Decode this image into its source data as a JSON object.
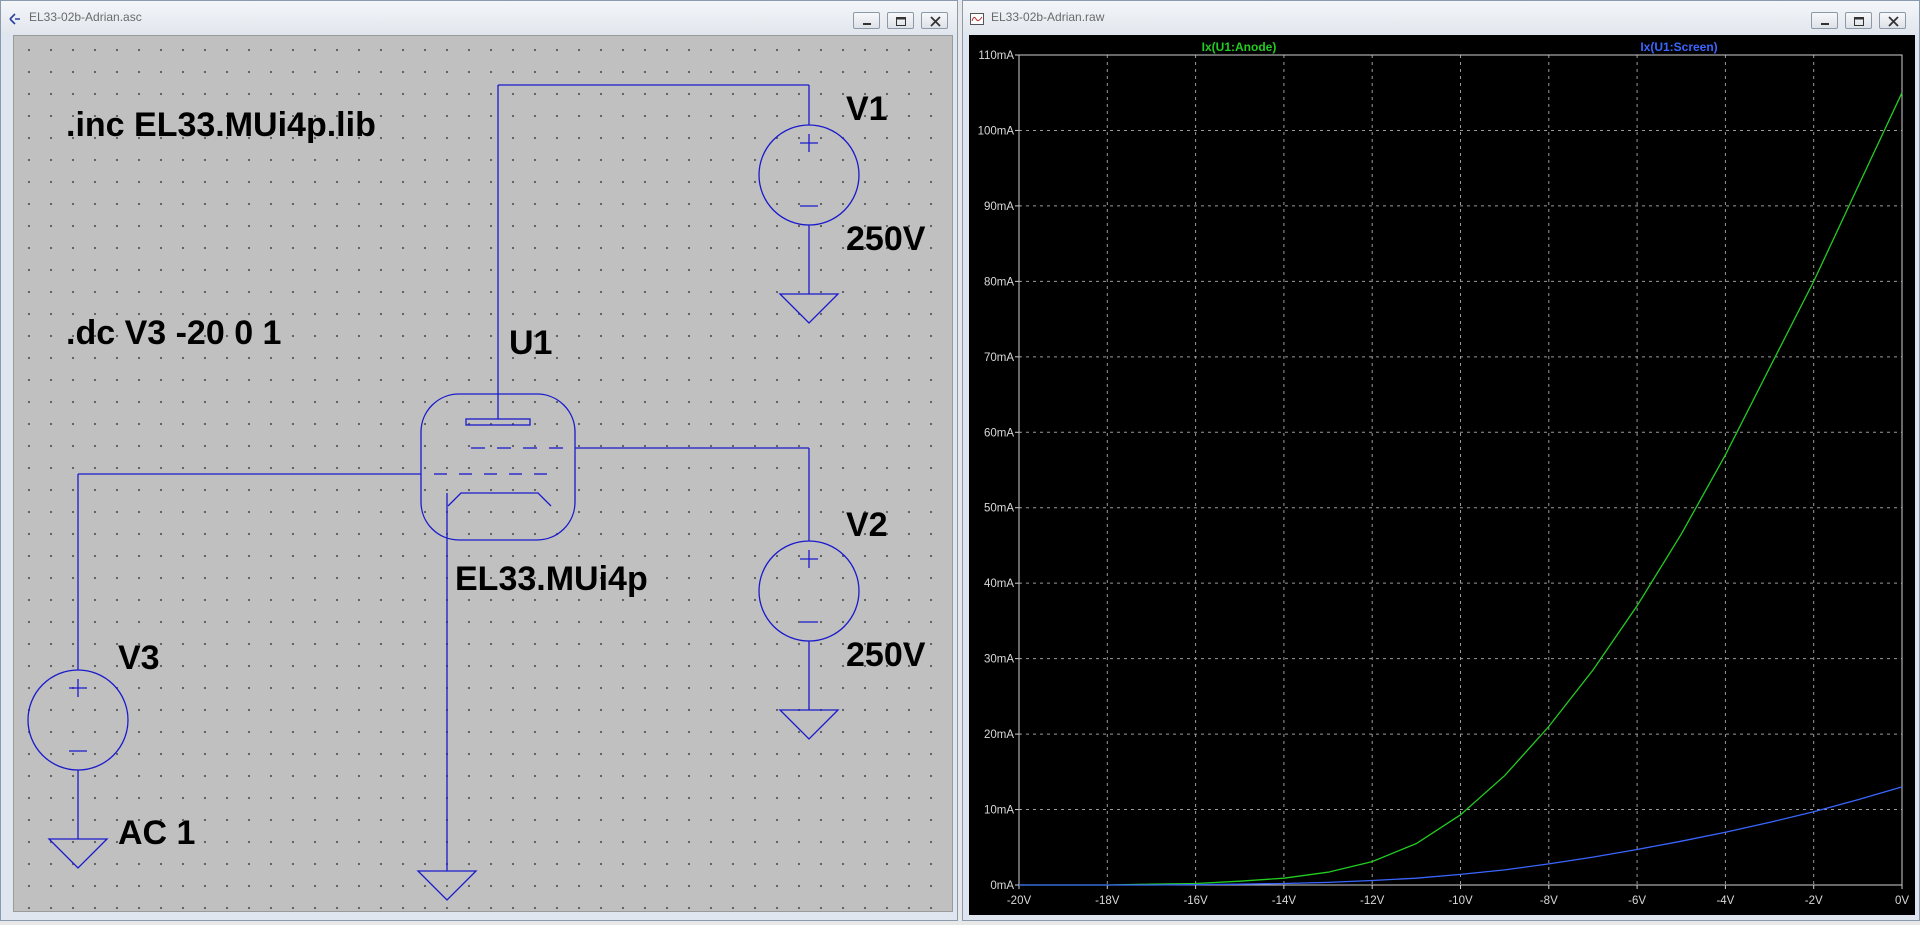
{
  "schematic_window": {
    "title": "EL33-02b-Adrian.asc",
    "directives": {
      "include": ".inc EL33.MUi4p.lib",
      "dc": ".dc V3 -20 0 1"
    },
    "components": {
      "v1": {
        "name": "V1",
        "value": "250V"
      },
      "v2": {
        "name": "V2",
        "value": "250V"
      },
      "v3": {
        "name": "V3",
        "value": "AC 1"
      },
      "u1": {
        "name": "U1",
        "model": "EL33.MUi4p"
      }
    },
    "wire_color": "#1a1acc",
    "background_color": "#c0c0c0"
  },
  "plot_window": {
    "title": "EL33-02b-Adrian.raw",
    "background_color": "#000000",
    "chart_data": {
      "type": "line",
      "title": "",
      "xlabel": "",
      "ylabel": "",
      "xlim": [
        -20,
        0
      ],
      "ylim": [
        0,
        110
      ],
      "grid": true,
      "legend_placement": "top",
      "x_ticks": [
        "-20V",
        "-18V",
        "-16V",
        "-14V",
        "-12V",
        "-10V",
        "-8V",
        "-6V",
        "-4V",
        "-2V",
        "0V"
      ],
      "y_ticks": [
        "0mA",
        "10mA",
        "20mA",
        "30mA",
        "40mA",
        "50mA",
        "60mA",
        "70mA",
        "80mA",
        "90mA",
        "100mA",
        "110mA"
      ],
      "x": [
        -20,
        -19,
        -18,
        -17,
        -16,
        -15,
        -14,
        -13,
        -12,
        -11,
        -10,
        -9,
        -8,
        -7,
        -6,
        -5,
        -4,
        -3,
        -2,
        -1,
        0
      ],
      "series": [
        {
          "name": "Ix(U1:Anode)",
          "color": "#22cc22",
          "values": [
            0,
            0,
            0,
            0.1,
            0.2,
            0.5,
            0.9,
            1.7,
            3.1,
            5.5,
            9.3,
            14.5,
            21,
            28.5,
            37,
            46.5,
            57,
            68.5,
            80,
            92.5,
            105
          ]
        },
        {
          "name": "Ix(U1:Screen)",
          "color": "#3a66ff",
          "values": [
            0,
            0,
            0,
            0,
            0.05,
            0.1,
            0.2,
            0.35,
            0.6,
            0.9,
            1.4,
            2,
            2.8,
            3.7,
            4.7,
            5.8,
            7,
            8.3,
            9.7,
            11.3,
            13
          ]
        }
      ]
    }
  }
}
